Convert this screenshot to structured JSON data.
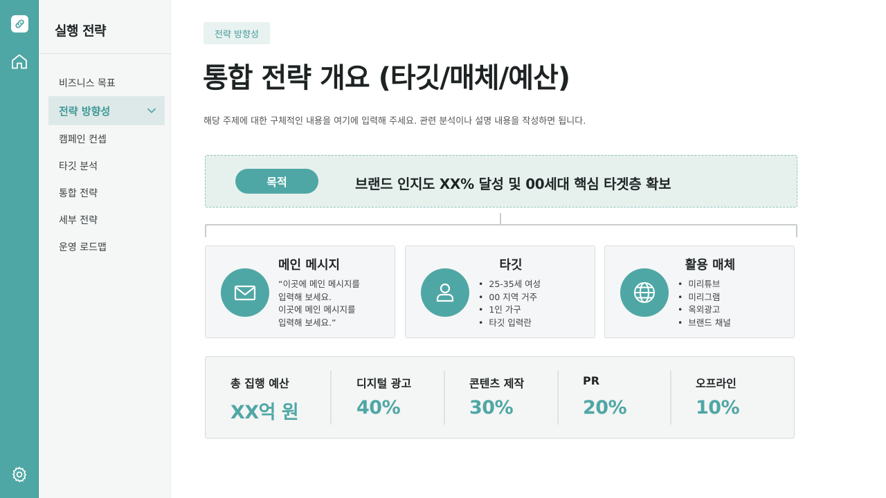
{
  "rail": {
    "logo_icon": "link-icon",
    "home_icon": "home-icon",
    "settings_icon": "gear-icon",
    "color": "#4fa7a5"
  },
  "sidebar": {
    "title": "실행 전략",
    "items": [
      {
        "label": "비즈니스 목표",
        "active": false
      },
      {
        "label": "전략 방향성",
        "active": true
      },
      {
        "label": "캠페인 컨셉",
        "active": false
      },
      {
        "label": "타깃 분석",
        "active": false
      },
      {
        "label": "통합 전략",
        "active": false
      },
      {
        "label": "세부 전략",
        "active": false
      },
      {
        "label": "운영 로드맵",
        "active": false
      }
    ]
  },
  "header": {
    "tag": "전략 방향성",
    "title": "통합 전략 개요 (타깃/매체/예산)",
    "description": "해당 주제에 대한 구체적인 내용을 여기에 입력해 주세요. 관련 분석이나 설명 내용을 작성하면 됩니다."
  },
  "goal": {
    "label": "목적",
    "text": "브랜드 인지도 XX% 달성 및 00세대 핵심 타겟층 확보"
  },
  "cards": [
    {
      "title": "메인 메시지",
      "icon": "mail-icon",
      "body": [
        "“이곳에 메인 메시지를",
        "입력해 보세요.",
        "이곳에 메인 메시지를",
        "입력해 보세요.”"
      ]
    },
    {
      "title": "타깃",
      "icon": "user-icon",
      "bullets": [
        "25-35세 여성",
        "00 지역 거주",
        "1인 가구",
        "타깃 입력란"
      ]
    },
    {
      "title": "활용 매체",
      "icon": "globe-icon",
      "bullets": [
        "미리튜브",
        "미리그램",
        "옥외광고",
        "브랜드 채널"
      ]
    }
  ],
  "budget": [
    {
      "label": "총 집행 예산",
      "value": "XX억 원"
    },
    {
      "label": "디지털 광고",
      "value": "40%"
    },
    {
      "label": "콘텐츠 제작",
      "value": "30%"
    },
    {
      "label": "PR",
      "value": "20%"
    },
    {
      "label": "오프라인",
      "value": "10%"
    }
  ],
  "colors": {
    "accent": "#4fa7a5",
    "accent_light": "#e6f1ee",
    "text": "#1f2424"
  }
}
